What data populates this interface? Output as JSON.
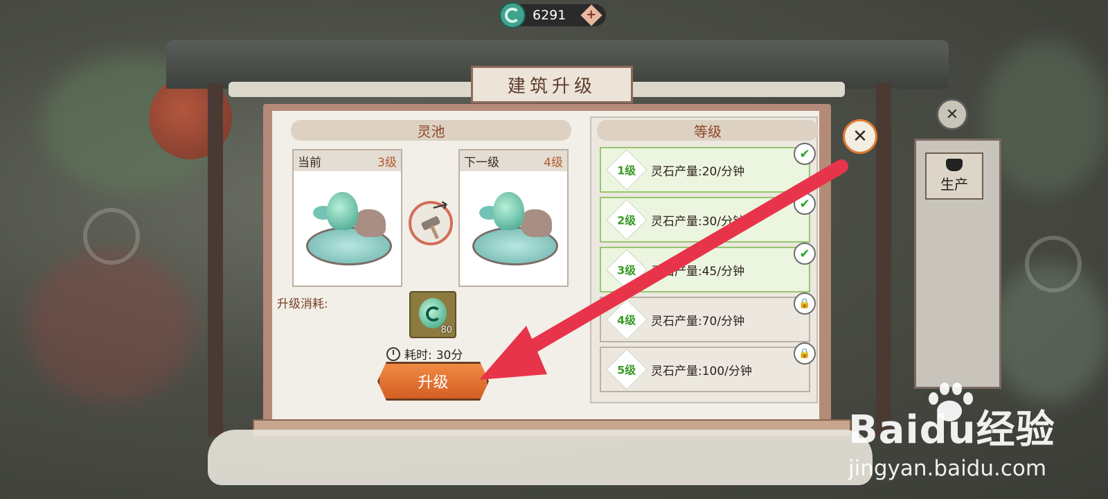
{
  "currency": {
    "amount": "6291",
    "icon": "jade-currency-icon",
    "add_icon": "plus-icon"
  },
  "title": "建筑升级",
  "building": {
    "name": "灵池",
    "current": {
      "label": "当前",
      "level": "3级"
    },
    "next": {
      "label": "下一级",
      "level": "4级"
    },
    "upgrade_icon": "hammer-upgrade-icon"
  },
  "cost": {
    "label": "升级消耗:",
    "item_icon": "jade-stone-icon",
    "quantity": "80",
    "time_label": "耗时:",
    "time_value": "30分",
    "button": "升级"
  },
  "levels": {
    "header": "等级",
    "rows": [
      {
        "badge": "1级",
        "text": "灵石产量:20/分钟",
        "status": "done"
      },
      {
        "badge": "2级",
        "text": "灵石产量:30/分钟",
        "status": "done"
      },
      {
        "badge": "3级",
        "text": "灵石产量:45/分钟",
        "status": "done"
      },
      {
        "badge": "4级",
        "text": "灵石产量:70/分钟",
        "status": "locked"
      },
      {
        "badge": "5级",
        "text": "灵石产量:100/分钟",
        "status": "locked"
      }
    ]
  },
  "side": {
    "produce_label": "生产"
  },
  "watermark": {
    "main": "Baidu经验",
    "sub": "jingyan.baidu.com"
  },
  "colors": {
    "accent_orange": "#e2702f",
    "arrow_red": "#e8344a",
    "done_green": "#2aa628"
  }
}
